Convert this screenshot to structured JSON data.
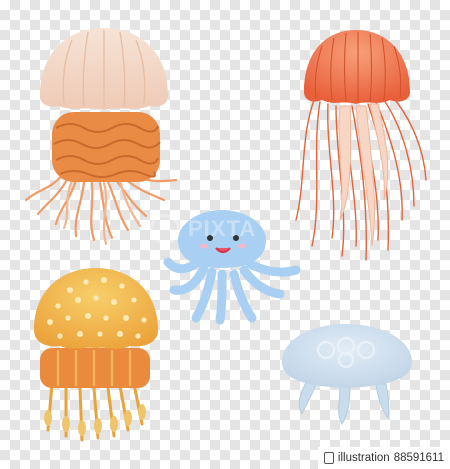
{
  "image": {
    "watermark_text": "PIXTA",
    "credit": {
      "prefix": "illustration",
      "id": "88591611",
      "logo": "pixta-logo-icon"
    },
    "background": "transparency-checkerboard"
  },
  "colors": {
    "peach_bell": "#f3d8c6",
    "orange_skirt": "#e98a45",
    "red_orange": "#ee7244",
    "blue_cute": "#a9d0f3",
    "yellow_spotted": "#f1b03c",
    "pale_blue": "#c9dcec"
  }
}
